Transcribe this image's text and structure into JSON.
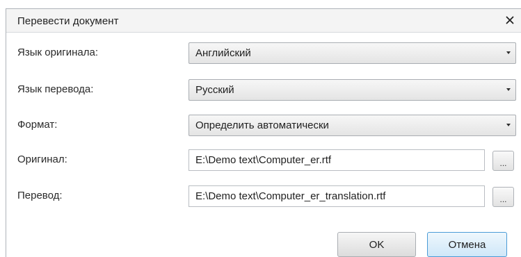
{
  "dialog": {
    "title": "Перевести документ",
    "close_glyph": "×",
    "close_icon": "close-icon"
  },
  "form": {
    "source_language": {
      "label": "Язык оригинала:",
      "value": "Английский"
    },
    "target_language": {
      "label": "Язык перевода:",
      "value": "Русский"
    },
    "format": {
      "label": "Формат:",
      "value": "Определить автоматически"
    },
    "original": {
      "label": "Оригинал:",
      "value": "E:\\Demo text\\Computer_er.rtf",
      "browse_label": "..."
    },
    "translation": {
      "label": "Перевод:",
      "value": "E:\\Demo text\\Computer_er_translation.rtf",
      "browse_label": "..."
    }
  },
  "buttons": {
    "ok_label": "OK",
    "cancel_label": "Отмена"
  },
  "colors": {
    "accent_border": "#4a9bd6",
    "titlebar_bg": "#f4f4f4"
  }
}
